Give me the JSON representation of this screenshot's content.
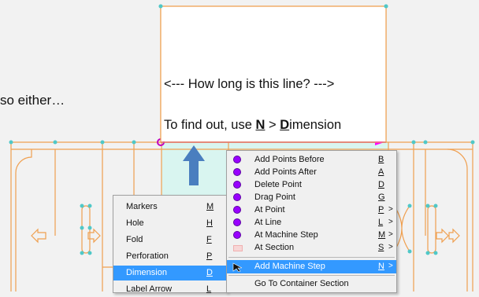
{
  "background_text": "so either…",
  "callout": {
    "line1": "<---   How long is this line? --->",
    "line2_prefix": "To find out, use ",
    "line2_N": "N",
    "line2_sep": " > ",
    "line2_D": "D",
    "line2_suffix": "imension"
  },
  "left_menu": {
    "items": [
      {
        "label": "Markers",
        "key": "M"
      },
      {
        "label": "Hole",
        "key": "H"
      },
      {
        "label": "Fold",
        "key": "F"
      },
      {
        "label": "Perforation",
        "key": "P"
      },
      {
        "label": "Dimension",
        "key": "D",
        "selected": true
      },
      {
        "label": "Label Arrow",
        "key": "L"
      }
    ]
  },
  "right_menu": {
    "items": [
      {
        "label": "Add Points Before",
        "key": "B",
        "icon": "purple-dot-icon"
      },
      {
        "label": "Add Points After",
        "key": "A",
        "icon": "purple-dot-icon"
      },
      {
        "label": "Delete Point",
        "key": "D",
        "icon": "purple-dot-icon"
      },
      {
        "label": "Drag Point",
        "key": "G",
        "icon": "purple-dot-icon"
      },
      {
        "label": "At Point",
        "key": "P",
        "icon": "purple-dot-icon",
        "submenu": ">"
      },
      {
        "label": "At Line",
        "key": "L",
        "icon": "purple-dot-icon",
        "submenu": ">"
      },
      {
        "label": "At Machine Step",
        "key": "M",
        "icon": "purple-dot-icon",
        "submenu": ">"
      },
      {
        "label": "At Section",
        "key": "S",
        "icon": "section-icon",
        "submenu": ">"
      },
      {
        "label": "Add Machine Step",
        "key": "N",
        "icon": "cursor-arrow-icon",
        "submenu": ">",
        "selected": true
      },
      {
        "label": "Go To Container Section",
        "key": "",
        "icon": ""
      }
    ]
  },
  "colors": {
    "outline": "#f0a050",
    "point": "#4fc8c8",
    "arrow": "#4a7ebf",
    "highlight_fill": "#d9f5f0",
    "selection": "#3399ff",
    "menu_dot": "#9900ff",
    "endpoint": "#ff00ff"
  }
}
